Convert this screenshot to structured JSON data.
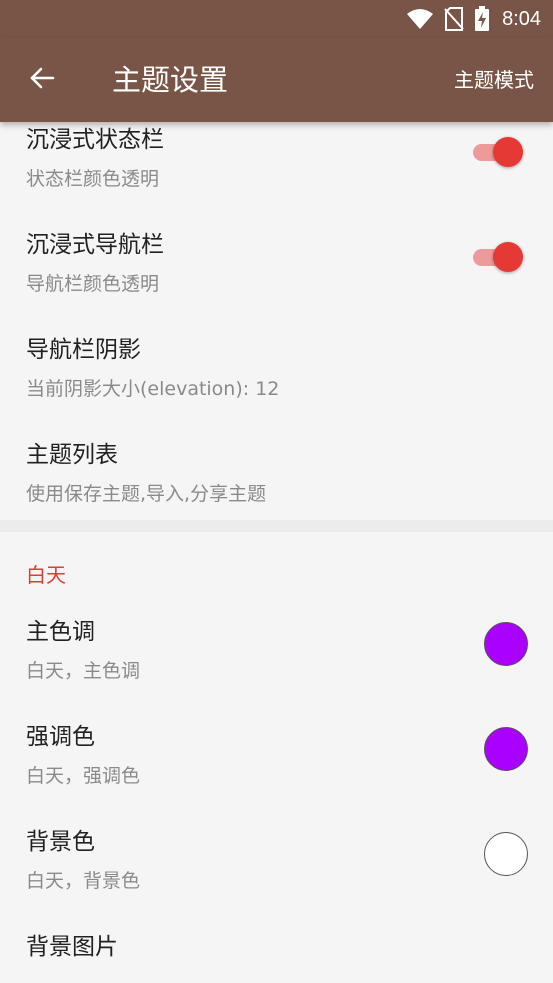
{
  "status_bar": {
    "time": "8:04",
    "icons": [
      "wifi-icon",
      "no-sim-icon",
      "battery-charging-icon"
    ]
  },
  "app_bar": {
    "back_icon": "arrow-left-icon",
    "title": "主题设置",
    "action_label": "主题模式",
    "color": "#795548"
  },
  "preferences": [
    {
      "title": "沉浸式状态栏",
      "summary": "状态栏颜色透明",
      "widget": "switch",
      "checked": true
    },
    {
      "title": "沉浸式导航栏",
      "summary": "导航栏颜色透明",
      "widget": "switch",
      "checked": true
    },
    {
      "title": "导航栏阴影",
      "summary": "当前阴影大小(elevation): 12"
    },
    {
      "title": "主题列表",
      "summary": "使用保存主题,导入,分享主题"
    }
  ],
  "day_section": {
    "header": "白天",
    "header_color": "#e53935",
    "items": [
      {
        "title": "主色调",
        "summary": "白天，主色调",
        "swatch_color": "#aa00ff"
      },
      {
        "title": "强调色",
        "summary": "白天，强调色",
        "swatch_color": "#aa00ff"
      },
      {
        "title": "背景色",
        "summary": "白天，背景色",
        "swatch_color": "#ffffff"
      },
      {
        "title": "背景图片"
      }
    ]
  },
  "colors": {
    "switch_thumb": "#e53935",
    "switch_track": "#ef9a9a"
  }
}
